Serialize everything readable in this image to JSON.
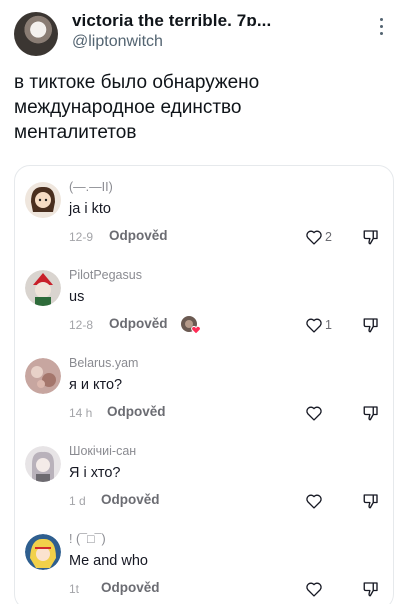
{
  "tweet": {
    "display_name": "victoria the terrible. 7ɒ...",
    "handle": "@liptonwitch",
    "text": "в тиктоке было обнаружено\nмеждународное единство\nменталитетов"
  },
  "comments": [
    {
      "username": "(—.—II)",
      "text": "ja i kto",
      "time": "12-9",
      "reply_label": "Odpověd",
      "likes": "2"
    },
    {
      "username": "PilotPegasus",
      "text": "us",
      "time": "12-8",
      "reply_label": "Odpověd",
      "likes": "1"
    },
    {
      "username": "Belarus.yam",
      "text": "я и кто?",
      "time": "14 h",
      "reply_label": "Odpověd",
      "likes": ""
    },
    {
      "username": "Шокічиі-сан",
      "text": "Я і хто?",
      "time": "1 d",
      "reply_label": "Odpověd",
      "likes": ""
    },
    {
      "username": "! (¯□¯)",
      "text": "Me and who",
      "time": "1t",
      "reply_label": "Odpověd",
      "likes": ""
    }
  ],
  "icons": {
    "more": "more-vertical-icon",
    "like": "heart-outline-icon",
    "dislike": "thumbs-down-outline-icon",
    "reaction": "creator-liked-badge"
  },
  "colors": {
    "text": "#0f1419",
    "muted": "#536471",
    "reaction_heart": "#fe2c55"
  }
}
